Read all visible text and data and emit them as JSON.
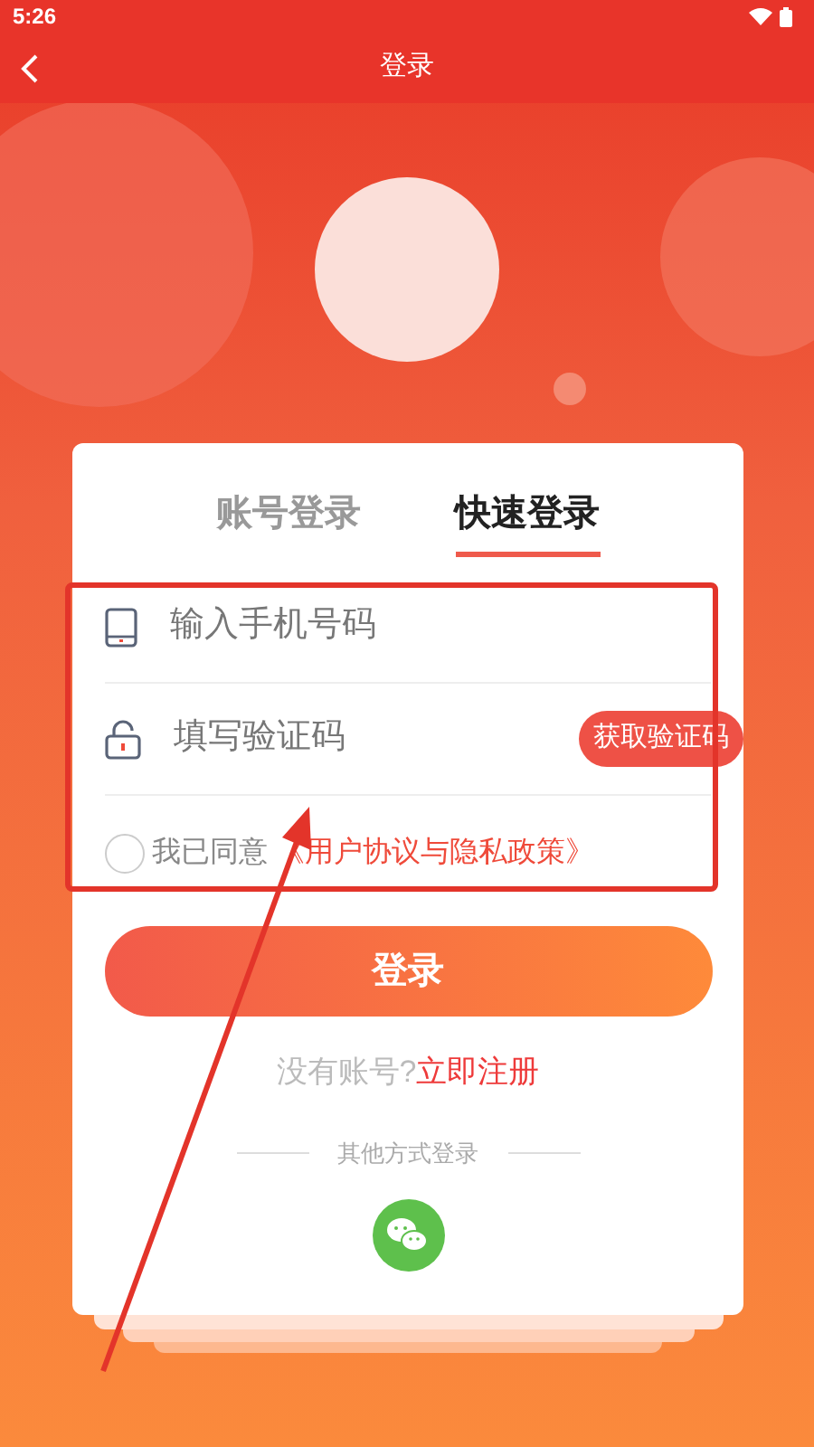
{
  "status_bar": {
    "time": "5:26"
  },
  "nav": {
    "title": "登录"
  },
  "tabs": [
    {
      "label": "账号登录",
      "selected": false
    },
    {
      "label": "快速登录",
      "selected": true
    }
  ],
  "fields": [
    {
      "kind": "phone",
      "placeholder": "输入手机号码"
    },
    {
      "kind": "code",
      "placeholder": "填写验证码",
      "action": "获取验证码"
    }
  ],
  "agreement": {
    "checked": false,
    "prefix": "我已同意",
    "link": "《用户协议与隐私政策》"
  },
  "login_button": "登录",
  "register": {
    "prompt": "没有账号?",
    "link": "立即注册"
  },
  "other_login": {
    "label": "其他方式登录"
  }
}
